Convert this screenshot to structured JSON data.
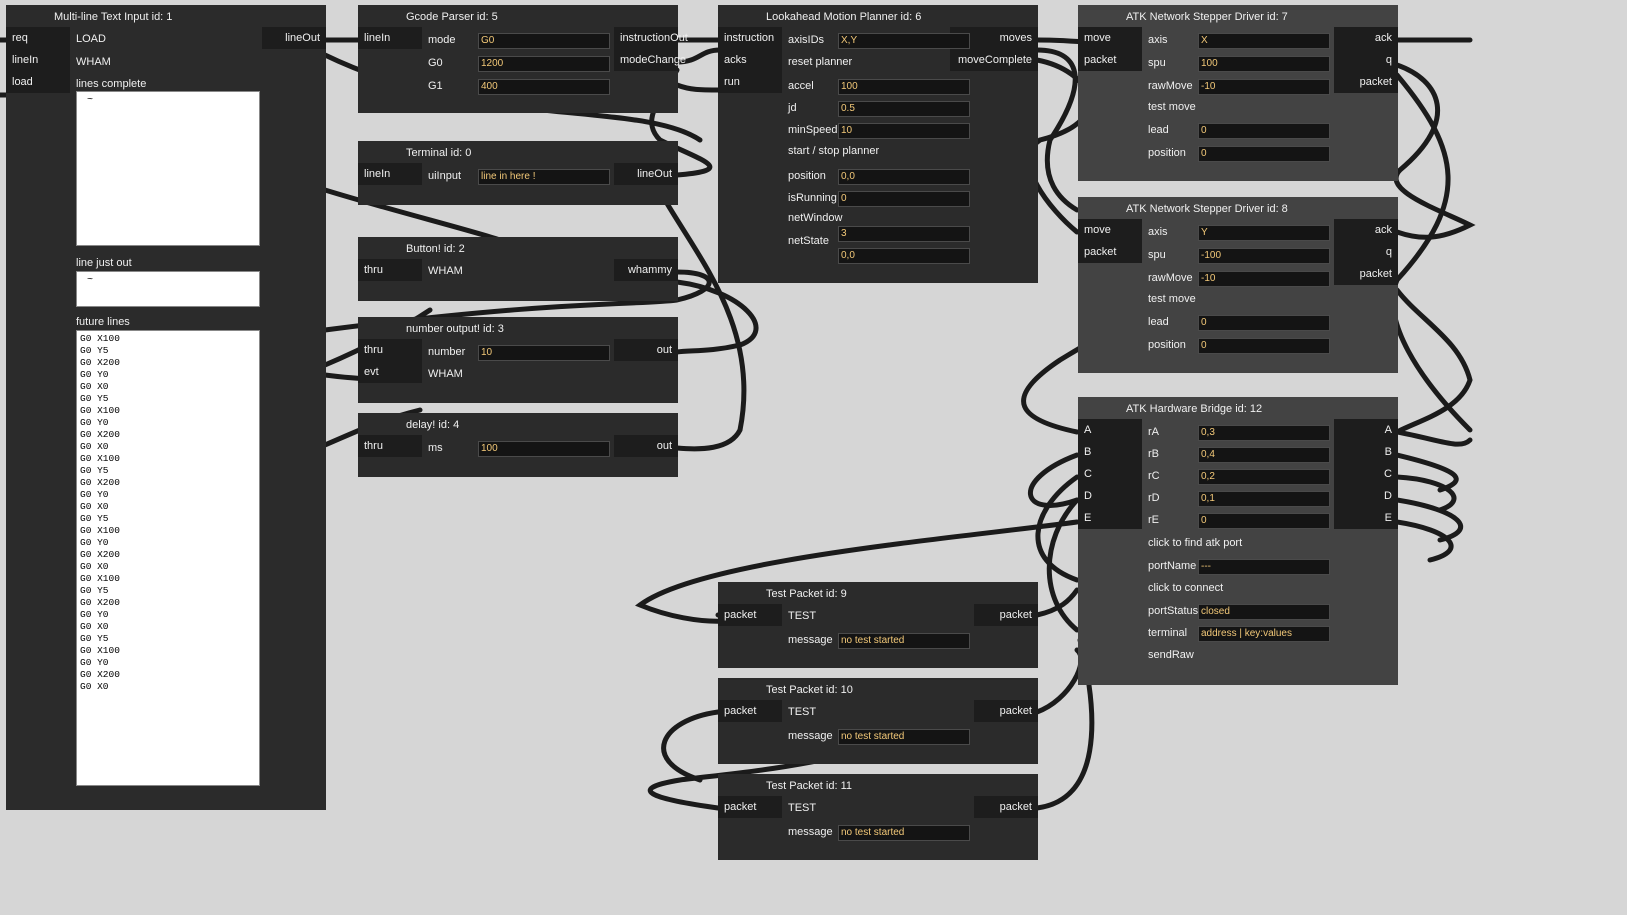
{
  "blocks": {
    "multiline": {
      "title": "Multi-line Text Input id: 1",
      "inputs": [
        "req",
        "lineIn",
        "load"
      ],
      "outputs": [
        "lineOut"
      ],
      "load_label": "LOAD",
      "wham_label": "WHAM",
      "lines_complete_label": "lines complete",
      "lines_complete_value": "~",
      "line_just_out_label": "line just out",
      "line_just_out_value": "~",
      "future_lines_label": "future lines",
      "future_lines": [
        "G0 X100",
        "G0 Y5",
        "G0 X200",
        "G0 Y0",
        "G0 X0",
        "G0 Y5",
        "G0 X100",
        "G0 Y0",
        "G0 X200",
        "G0 X0",
        "G0 X100",
        "G0 Y5",
        "G0 X200",
        "G0 Y0",
        "G0 X0",
        "G0 Y5",
        "G0 X100",
        "G0 Y0",
        "G0 X200",
        "G0 X0",
        "G0 X100",
        "G0 Y5",
        "G0 X200",
        "G0 Y0",
        "G0 X0",
        "G0 Y5",
        "G0 X100",
        "G0 Y0",
        "G0 X200",
        "G0 X0"
      ]
    },
    "gcode": {
      "title": "Gcode Parser id: 5",
      "inputs": [
        "lineIn"
      ],
      "outputs": [
        "instructionOut",
        "modeChange"
      ],
      "rows": [
        {
          "label": "mode",
          "value": "G0"
        },
        {
          "label": "G0",
          "value": "1200"
        },
        {
          "label": "G1",
          "value": "400"
        }
      ]
    },
    "terminal": {
      "title": "Terminal id: 0",
      "inputs": [
        "lineIn"
      ],
      "outputs": [
        "lineOut"
      ],
      "rows": [
        {
          "label": "uiInput",
          "value": "line in here !"
        }
      ]
    },
    "button": {
      "title": "Button! id: 2",
      "inputs": [
        "thru"
      ],
      "outputs": [
        "whammy"
      ],
      "text": "WHAM"
    },
    "numout": {
      "title": "number output! id: 3",
      "inputs": [
        "thru",
        "evt"
      ],
      "outputs": [
        "out"
      ],
      "rows": [
        {
          "label": "number",
          "value": "10"
        }
      ],
      "text": "WHAM"
    },
    "delay": {
      "title": "delay! id: 4",
      "inputs": [
        "thru"
      ],
      "outputs": [
        "out"
      ],
      "rows": [
        {
          "label": "ms",
          "value": "100"
        }
      ]
    },
    "planner": {
      "title": "Lookahead Motion Planner id: 6",
      "inputs": [
        "instruction",
        "acks",
        "run"
      ],
      "outputs": [
        "moves",
        "moveComplete"
      ],
      "axisIDs": {
        "label": "axisIDs",
        "value": "X,Y"
      },
      "reset": "reset planner",
      "accel": {
        "label": "accel",
        "value": "100"
      },
      "jd": {
        "label": "jd",
        "value": "0.5"
      },
      "minSpeed": {
        "label": "minSpeed",
        "value": "10"
      },
      "startstop": "start / stop planner",
      "position": {
        "label": "position",
        "value": "0,0"
      },
      "isRunning": {
        "label": "isRunning",
        "value": "0"
      },
      "netWindow": "netWindow",
      "netWindowValue": "3",
      "netState": {
        "label": "netState",
        "value": "0,0"
      }
    },
    "stepper7": {
      "title": "ATK Network Stepper Driver id: 7",
      "inputs": [
        "move",
        "packet"
      ],
      "outputs": [
        "ack",
        "q",
        "packet"
      ],
      "axis": {
        "label": "axis",
        "value": "X"
      },
      "spu": {
        "label": "spu",
        "value": "100"
      },
      "rawMove": {
        "label": "rawMove",
        "value": "-10"
      },
      "testmove": "test move",
      "lead": {
        "label": "lead",
        "value": "0"
      },
      "position": {
        "label": "position",
        "value": "0"
      }
    },
    "stepper8": {
      "title": "ATK Network Stepper Driver id: 8",
      "inputs": [
        "move",
        "packet"
      ],
      "outputs": [
        "ack",
        "q",
        "packet"
      ],
      "axis": {
        "label": "axis",
        "value": "Y"
      },
      "spu": {
        "label": "spu",
        "value": "-100"
      },
      "rawMove": {
        "label": "rawMove",
        "value": "-10"
      },
      "testmove": "test move",
      "lead": {
        "label": "lead",
        "value": "0"
      },
      "position": {
        "label": "position",
        "value": "0"
      }
    },
    "bridge": {
      "title": "ATK Hardware Bridge id: 12",
      "inputs": [
        "A",
        "B",
        "C",
        "D",
        "E"
      ],
      "outputs": [
        "A",
        "B",
        "C",
        "D",
        "E"
      ],
      "rA": {
        "label": "rA",
        "value": "0,3"
      },
      "rB": {
        "label": "rB",
        "value": "0,4"
      },
      "rC": {
        "label": "rC",
        "value": "0,2"
      },
      "rD": {
        "label": "rD",
        "value": "0,1"
      },
      "rE": {
        "label": "rE",
        "value": "0"
      },
      "findport": "click to find atk port",
      "portName": {
        "label": "portName",
        "value": "---"
      },
      "connect": "click to connect",
      "portStatus": {
        "label": "portStatus",
        "value": "closed"
      },
      "terminal": {
        "label": "terminal",
        "value": "address | key:values"
      },
      "sendRaw": "sendRaw"
    },
    "test9": {
      "title": "Test Packet id: 9",
      "inputs": [
        "packet"
      ],
      "outputs": [
        "packet"
      ],
      "text": "TEST",
      "message": {
        "label": "message",
        "value": "no test started"
      }
    },
    "test10": {
      "title": "Test Packet id: 10",
      "inputs": [
        "packet"
      ],
      "outputs": [
        "packet"
      ],
      "text": "TEST",
      "message": {
        "label": "message",
        "value": "no test started"
      }
    },
    "test11": {
      "title": "Test Packet id: 11",
      "inputs": [
        "packet"
      ],
      "outputs": [
        "packet"
      ],
      "text": "TEST",
      "message": {
        "label": "message",
        "value": "no test started"
      }
    }
  }
}
